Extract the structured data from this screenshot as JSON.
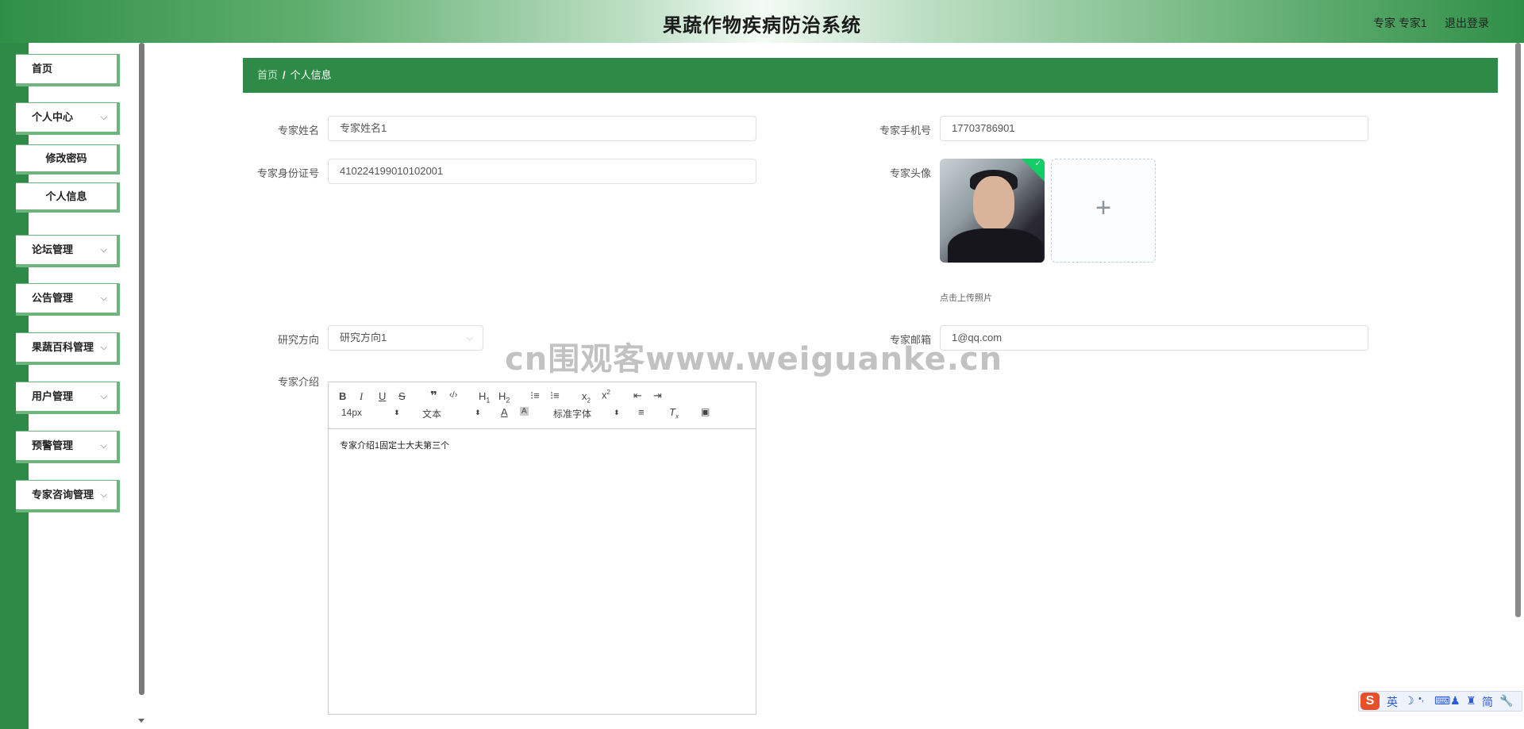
{
  "header": {
    "title": "果蔬作物疾病防治系统",
    "user": "专家 专家1",
    "logout": "退出登录"
  },
  "sidebar": {
    "items": [
      {
        "label": "首页",
        "chevron": ""
      },
      {
        "label": "个人中心",
        "chevron": "⌵"
      },
      {
        "label": "修改密码",
        "chevron": ""
      },
      {
        "label": "个人信息",
        "chevron": ""
      },
      {
        "label": "论坛管理",
        "chevron": "⌵"
      },
      {
        "label": "公告管理",
        "chevron": "⌵"
      },
      {
        "label": "果蔬百科管理",
        "chevron": "⌵"
      },
      {
        "label": "用户管理",
        "chevron": "⌵"
      },
      {
        "label": "预警管理",
        "chevron": "⌵"
      },
      {
        "label": "专家咨询管理",
        "chevron": "⌵"
      }
    ]
  },
  "breadcrumb": {
    "home": "首页",
    "separator": "/",
    "current": "个人信息"
  },
  "form": {
    "name_label": "专家姓名",
    "name_value": "专家姓名1",
    "phone_label": "专家手机号",
    "phone_value": "17703786901",
    "id_label": "专家身份证号",
    "id_value": "410224199010102001",
    "avatar_label": "专家头像",
    "upload_plus": "+",
    "upload_hint": "点击上传照片",
    "research_label": "研究方向",
    "research_value": "研究方向1",
    "email_label": "专家邮箱",
    "email_value": "1@qq.com",
    "intro_label": "专家介绍",
    "intro_content": "专家介绍1固定士大夫第三个"
  },
  "editor": {
    "font_size": "14px",
    "block_type": "文本",
    "font_family": "标准字体",
    "toolbar_icons": [
      "bold-icon",
      "italic-icon",
      "underline-icon",
      "strike-icon",
      "quote-icon",
      "code-icon",
      "h1-icon",
      "h2-icon",
      "ordered-list-icon",
      "bullet-list-icon",
      "subscript-icon",
      "superscript-icon",
      "outdent-icon",
      "indent-icon",
      "font-color-icon",
      "background-color-icon",
      "align-icon",
      "clear-format-icon",
      "image-icon"
    ]
  },
  "watermark": "cn围观客www.weiguanke.cn",
  "ime": {
    "lang": "英",
    "mode": "简"
  },
  "colors": {
    "primary": "#2e8b47",
    "menu_border": "#6fb37d",
    "success": "#13ce66"
  }
}
